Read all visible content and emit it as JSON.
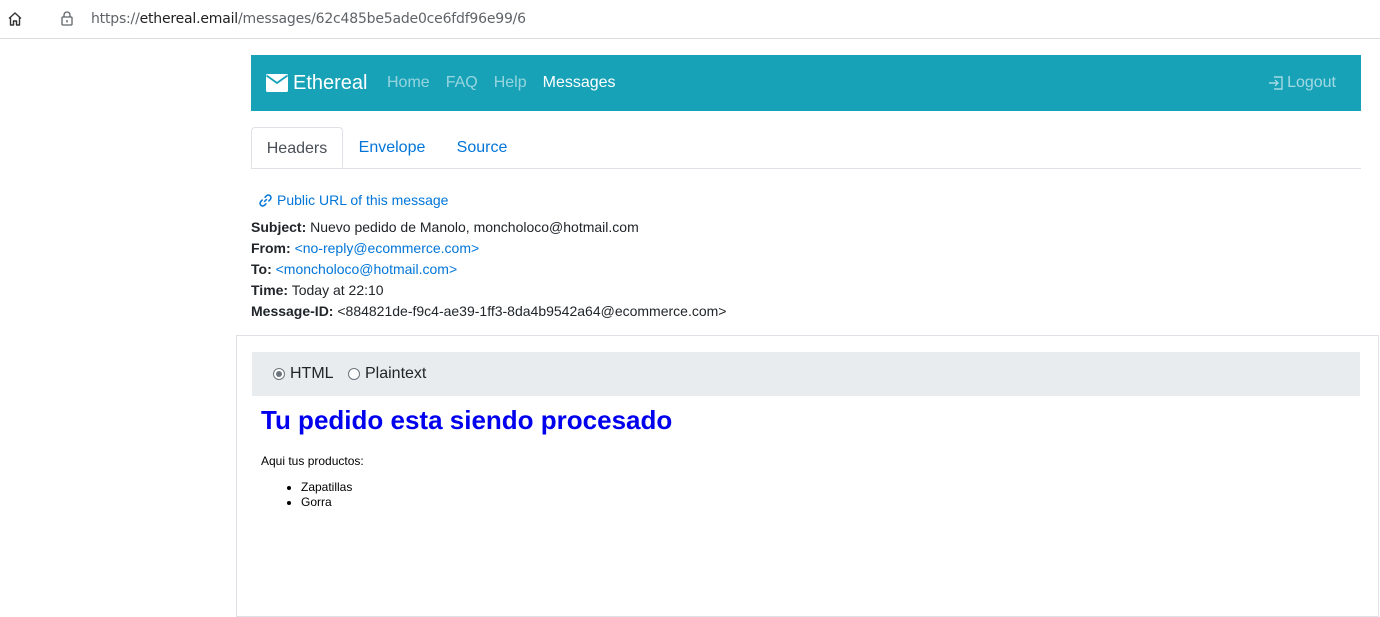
{
  "browser": {
    "url_prefix": "https://",
    "url_host": "ethereal.email",
    "url_path": "/messages/62c485be5ade0ce6fdf96e99/6",
    "icons": [
      "home-icon",
      "lock-icon"
    ]
  },
  "navbar": {
    "brand": "Ethereal",
    "links": [
      "Home",
      "FAQ",
      "Help",
      "Messages"
    ],
    "active_link": "Messages",
    "logout": "Logout",
    "bg_color": "#17a2b8"
  },
  "tabs": [
    "Headers",
    "Envelope",
    "Source"
  ],
  "active_tab": "Headers",
  "message": {
    "public_url_label": "Public URL of this message",
    "subject_label": "Subject:",
    "subject": "Nuevo pedido de Manolo, moncholoco@hotmail.com",
    "from_label": "From:",
    "from": "<no-reply@ecommerce.com>",
    "to_label": "To:",
    "to": "<moncholoco@hotmail.com>",
    "time_label": "Time:",
    "time": "Today at 22:10",
    "message_id_label": "Message-ID:",
    "message_id": "<884821de-f9c4-ae39-1ff3-8da4b9542a64@ecommerce.com>"
  },
  "format_options": {
    "html": "HTML",
    "plaintext": "Plaintext",
    "selected": "HTML"
  },
  "email_body": {
    "title": "Tu pedido esta siendo procesado",
    "intro": "Aqui tus productos:",
    "items": [
      "Zapatillas",
      "Gorra"
    ]
  }
}
